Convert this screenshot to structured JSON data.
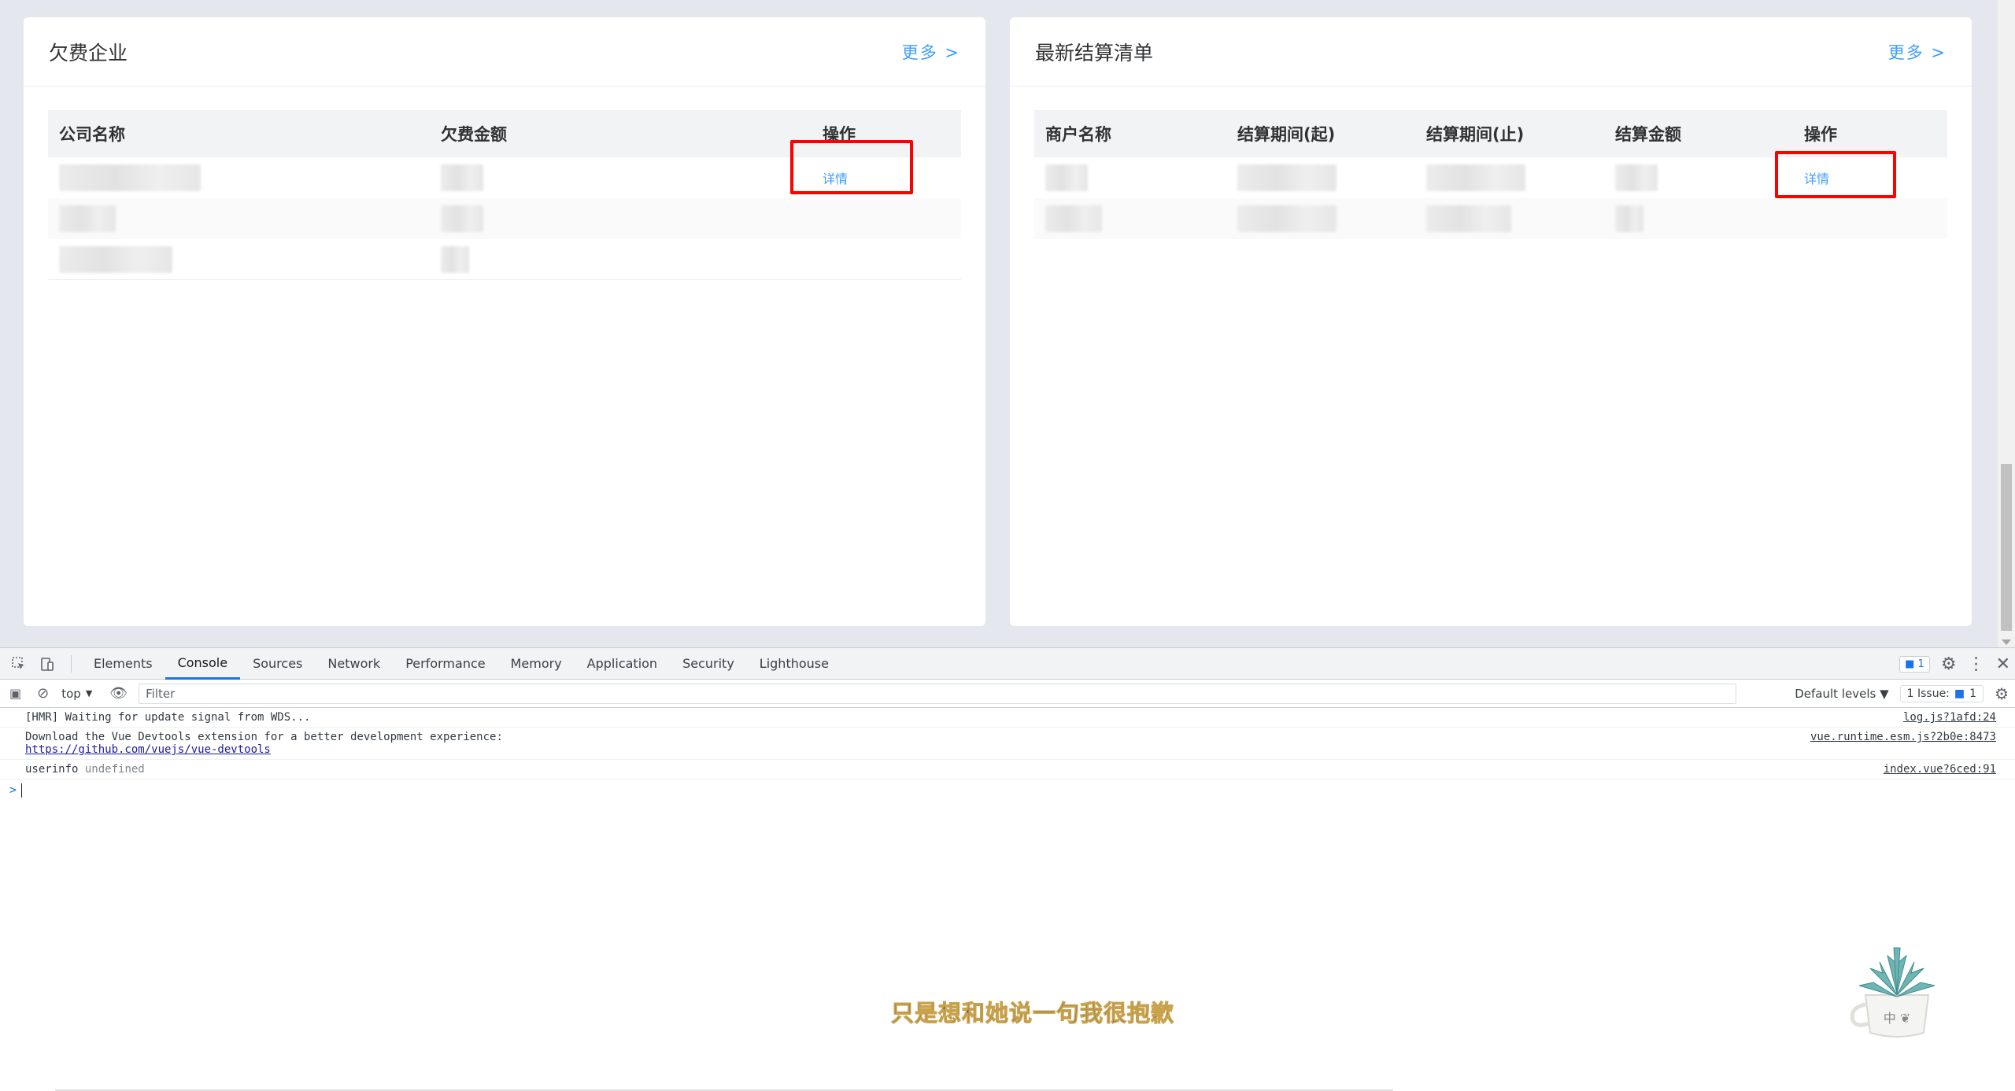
{
  "left_card": {
    "title": "欠费企业",
    "more": "更多 >",
    "headers": [
      "公司名称",
      "欠费金额",
      "操作"
    ],
    "detail_label": "详情"
  },
  "right_card": {
    "title": "最新结算清单",
    "more": "更多 >",
    "headers": [
      "商户名称",
      "结算期间(起)",
      "结算期间(止)",
      "结算金额",
      "操作"
    ],
    "detail_label": "详情"
  },
  "devtools": {
    "tabs": [
      "Elements",
      "Console",
      "Sources",
      "Network",
      "Performance",
      "Memory",
      "Application",
      "Security",
      "Lighthouse"
    ],
    "active_tab": "Console",
    "messages_badge": "1",
    "context": "top",
    "filter_placeholder": "Filter",
    "levels": "Default levels",
    "issues": "1 Issue:",
    "issues_count": "1",
    "console": [
      {
        "text": "[HMR] Waiting for update signal from WDS...",
        "source": "log.js?1afd:24"
      },
      {
        "text": "Download the Vue Devtools extension for a better development experience:",
        "link": "https://github.com/vuejs/vue-devtools",
        "source": "vue.runtime.esm.js?2b0e:8473"
      },
      {
        "text": "userinfo",
        "value": "undefined",
        "source": "index.vue?6ced:91"
      }
    ],
    "prompt": ">"
  },
  "subtitle": "只是想和她说一句我很抱歉",
  "plant_label": "中 ❦",
  "colors": {
    "accent": "#409eff",
    "highlight": "#ff0000",
    "devtools_blue": "#1a73e8"
  }
}
